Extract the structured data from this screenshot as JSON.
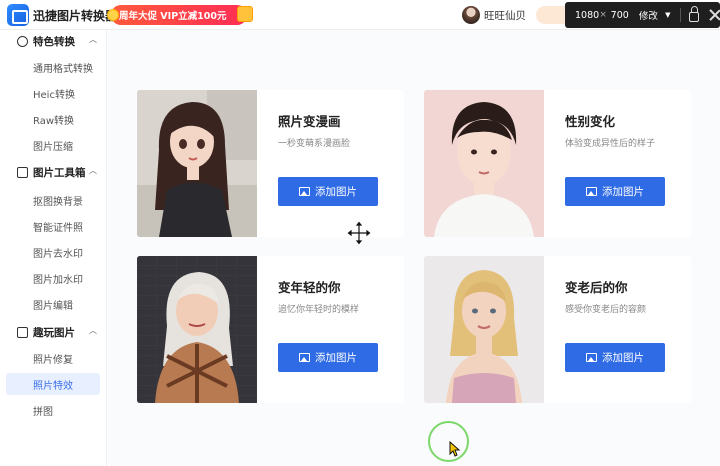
{
  "app": {
    "name": "迅捷图片转换器",
    "promo_text": "周年大促 VIP立减100元"
  },
  "user": {
    "name": "旺旺仙贝"
  },
  "dimension_overlay": {
    "width": "1080",
    "sep": "×",
    "height": "700",
    "modify": "修改",
    "arrow": "▼"
  },
  "sidebar": {
    "groups": [
      {
        "label": "特色转换",
        "chevron": "︿",
        "items": [
          "通用格式转换",
          "Heic转换",
          "Raw转换",
          "图片压缩"
        ]
      },
      {
        "label": "图片工具箱",
        "chevron": "︿",
        "items": [
          "抠图换背景",
          "智能证件照",
          "图片去水印",
          "图片加水印",
          "图片编辑"
        ]
      },
      {
        "label": "趣玩图片",
        "chevron": "︿",
        "items": [
          "照片修复",
          "照片特效",
          "拼图"
        ]
      }
    ],
    "active_item": "照片特效"
  },
  "cards": [
    {
      "title": "照片变漫画",
      "subtitle": "一秒变萌系漫画脸",
      "button": "添加图片"
    },
    {
      "title": "性别变化",
      "subtitle": "体验变成异性后的样子",
      "button": "添加图片"
    },
    {
      "title": "变年轻的你",
      "subtitle": "追忆你年轻时的模样",
      "button": "添加图片"
    },
    {
      "title": "变老后的你",
      "subtitle": "感受你变老后的容颜",
      "button": "添加图片"
    }
  ],
  "colors": {
    "accent": "#2f6be5",
    "promo": "#ff2d55",
    "active_bg": "#e8f0ff",
    "click_ring": "#7cd86a"
  }
}
